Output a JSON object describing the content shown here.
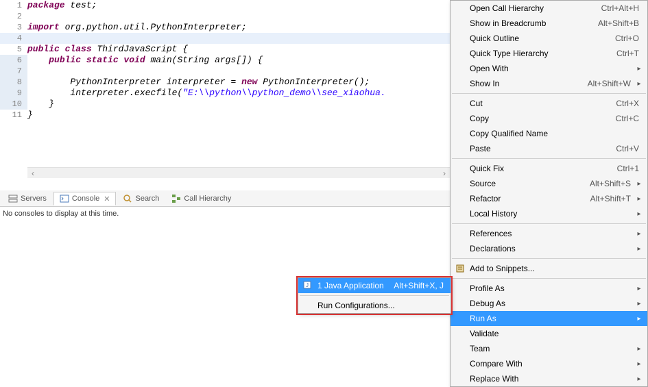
{
  "code": {
    "lines": [
      {
        "n": "1",
        "tokens": [
          {
            "t": "package ",
            "c": "kw"
          },
          {
            "t": "test;",
            "c": "normal"
          }
        ]
      },
      {
        "n": "2",
        "tokens": []
      },
      {
        "n": "3",
        "tokens": [
          {
            "t": "import ",
            "c": "kw"
          },
          {
            "t": "org.python.util.PythonInterpreter;",
            "c": "normal"
          }
        ]
      },
      {
        "n": "4",
        "tokens": [],
        "current": true
      },
      {
        "n": "5",
        "tokens": [
          {
            "t": "public class ",
            "c": "kw"
          },
          {
            "t": "ThirdJavaScript {",
            "c": "normal"
          }
        ]
      },
      {
        "n": "6",
        "hl": true,
        "tokens": [
          {
            "t": "    ",
            "c": "normal"
          },
          {
            "t": "public static void ",
            "c": "kw"
          },
          {
            "t": "main(String args[]) {",
            "c": "normal"
          }
        ]
      },
      {
        "n": "7",
        "hl": true,
        "tokens": []
      },
      {
        "n": "8",
        "hl": true,
        "tokens": [
          {
            "t": "        PythonInterpreter interpreter = ",
            "c": "normal"
          },
          {
            "t": "new ",
            "c": "kw"
          },
          {
            "t": "PythonInterpreter();",
            "c": "normal"
          }
        ]
      },
      {
        "n": "9",
        "hl": true,
        "tokens": [
          {
            "t": "        interpreter.execfile(",
            "c": "normal"
          },
          {
            "t": "\"E:\\\\python\\\\python_demo\\\\see_xiaohua.",
            "c": "str"
          }
        ]
      },
      {
        "n": "10",
        "hl": true,
        "tokens": [
          {
            "t": "    }",
            "c": "normal"
          }
        ]
      },
      {
        "n": "11",
        "tokens": [
          {
            "t": "}",
            "c": "normal"
          }
        ]
      }
    ]
  },
  "tabs": {
    "items": [
      {
        "id": "servers",
        "label": "Servers",
        "icon": "server",
        "active": false
      },
      {
        "id": "console",
        "label": "Console",
        "icon": "console",
        "active": true,
        "closable": true
      },
      {
        "id": "search",
        "label": "Search",
        "icon": "search",
        "active": false
      },
      {
        "id": "callhier",
        "label": "Call Hierarchy",
        "icon": "callhier",
        "active": false
      }
    ],
    "console_message": "No consoles to display at this time."
  },
  "menu": {
    "items": [
      {
        "label": "Open Call Hierarchy",
        "shortcut": "Ctrl+Alt+H"
      },
      {
        "label": "Show in Breadcrumb",
        "shortcut": "Alt+Shift+B"
      },
      {
        "label": "Quick Outline",
        "shortcut": "Ctrl+O"
      },
      {
        "label": "Quick Type Hierarchy",
        "shortcut": "Ctrl+T"
      },
      {
        "label": "Open With",
        "sub": true
      },
      {
        "label": "Show In",
        "shortcut": "Alt+Shift+W",
        "sub": true
      },
      {
        "sep": true
      },
      {
        "label": "Cut",
        "shortcut": "Ctrl+X"
      },
      {
        "label": "Copy",
        "shortcut": "Ctrl+C"
      },
      {
        "label": "Copy Qualified Name"
      },
      {
        "label": "Paste",
        "shortcut": "Ctrl+V"
      },
      {
        "sep": true
      },
      {
        "label": "Quick Fix",
        "shortcut": "Ctrl+1"
      },
      {
        "label": "Source",
        "shortcut": "Alt+Shift+S",
        "sub": true
      },
      {
        "label": "Refactor",
        "shortcut": "Alt+Shift+T",
        "sub": true
      },
      {
        "label": "Local History",
        "sub": true
      },
      {
        "sep": true
      },
      {
        "label": "References",
        "sub": true
      },
      {
        "label": "Declarations",
        "sub": true
      },
      {
        "sep": true
      },
      {
        "label": "Add to Snippets...",
        "icon": "snippet"
      },
      {
        "sep": true
      },
      {
        "label": "Profile As",
        "sub": true
      },
      {
        "label": "Debug As",
        "sub": true
      },
      {
        "label": "Run As",
        "sub": true,
        "selected": true
      },
      {
        "label": "Validate"
      },
      {
        "label": "Team",
        "sub": true
      },
      {
        "label": "Compare With",
        "sub": true
      },
      {
        "label": "Replace With",
        "sub": true
      }
    ]
  },
  "submenu": {
    "items": [
      {
        "label": "1 Java Application",
        "shortcut": "Alt+Shift+X, J",
        "icon": "java",
        "hover": true
      },
      {
        "sep": true
      },
      {
        "label": "Run Configurations..."
      }
    ]
  }
}
